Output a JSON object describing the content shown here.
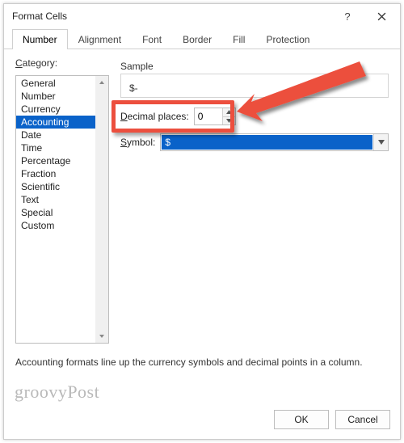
{
  "titlebar": {
    "title": "Format Cells"
  },
  "tabs": {
    "number": "Number",
    "alignment": "Alignment",
    "font": "Font",
    "border": "Border",
    "fill": "Fill",
    "protection": "Protection"
  },
  "categoryLabel": "Category:",
  "categories": [
    "General",
    "Number",
    "Currency",
    "Accounting",
    "Date",
    "Time",
    "Percentage",
    "Fraction",
    "Scientific",
    "Text",
    "Special",
    "Custom"
  ],
  "selectedCategoryIndex": 3,
  "sampleLabel": "Sample",
  "sampleValue": "$-",
  "decimalPlacesLabel": "Decimal places:",
  "decimalPlacesValue": "0",
  "symbolLabel": "Symbol:",
  "symbolValue": "$",
  "description": "Accounting formats line up the currency symbols and decimal points in a column.",
  "buttons": {
    "ok": "OK",
    "cancel": "Cancel"
  },
  "watermark": "groovyPost"
}
